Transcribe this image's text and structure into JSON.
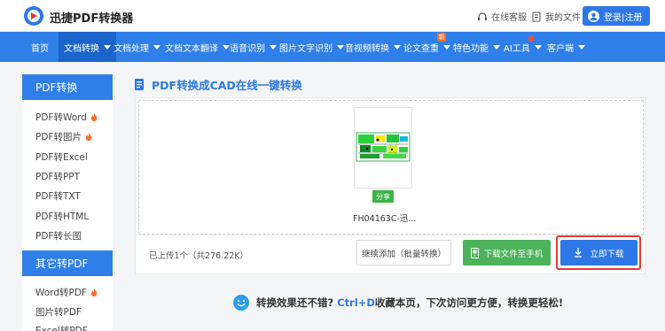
{
  "header": {
    "brand": "迅捷PDF转换器",
    "service_label": "在线客服",
    "files_label": "我的文件",
    "login_label": "登录|注册"
  },
  "nav": {
    "items": [
      {
        "label": "首页"
      },
      {
        "label": "文档转换"
      },
      {
        "label": "文档处理"
      },
      {
        "label": "文档文本翻译"
      },
      {
        "label": "语音识别"
      },
      {
        "label": "图片文字识别"
      },
      {
        "label": "音视频转换"
      },
      {
        "label": "论文查重"
      },
      {
        "label": "特色功能"
      },
      {
        "label": "AI工具"
      },
      {
        "label": "客户端"
      }
    ],
    "new_badge": "新"
  },
  "sidebar": {
    "section1_title": "PDF转换",
    "section1_items": [
      {
        "label": "PDF转Word",
        "hot": true
      },
      {
        "label": "PDF转图片",
        "hot": true
      },
      {
        "label": "PDF转Excel",
        "hot": false
      },
      {
        "label": "PDF转PPT",
        "hot": false
      },
      {
        "label": "PDF转TXT",
        "hot": false
      },
      {
        "label": "PDF转HTML",
        "hot": false
      },
      {
        "label": "PDF转长图",
        "hot": false
      }
    ],
    "section2_title": "其它转PDF",
    "section2_items": [
      {
        "label": "Word转PDF",
        "hot": true
      },
      {
        "label": "图片转PDF",
        "hot": false
      },
      {
        "label": "Excel转PDF",
        "hot": false
      }
    ]
  },
  "main": {
    "title": "PDF转换成CAD在线一键转换",
    "file": {
      "name": "FH04163C-迅...",
      "share_label": "分享"
    },
    "upload_info": "已上传1个（共276.22K）",
    "add_button": "继续添加（批量转换）",
    "phone_button": "下载文件至手机",
    "download_button": "立即下载",
    "tip": {
      "prefix": "转换效果还不错?",
      "shortcut": "Ctrl+D",
      "suffix": "收藏本页，下次访问更方便，转换更轻松!"
    }
  },
  "colors": {
    "primary": "#2f7fe9",
    "nav_active": "#1b64cb",
    "green": "#4cb35a",
    "highlight_red": "#e53935",
    "hot": "#ff6a2a"
  }
}
